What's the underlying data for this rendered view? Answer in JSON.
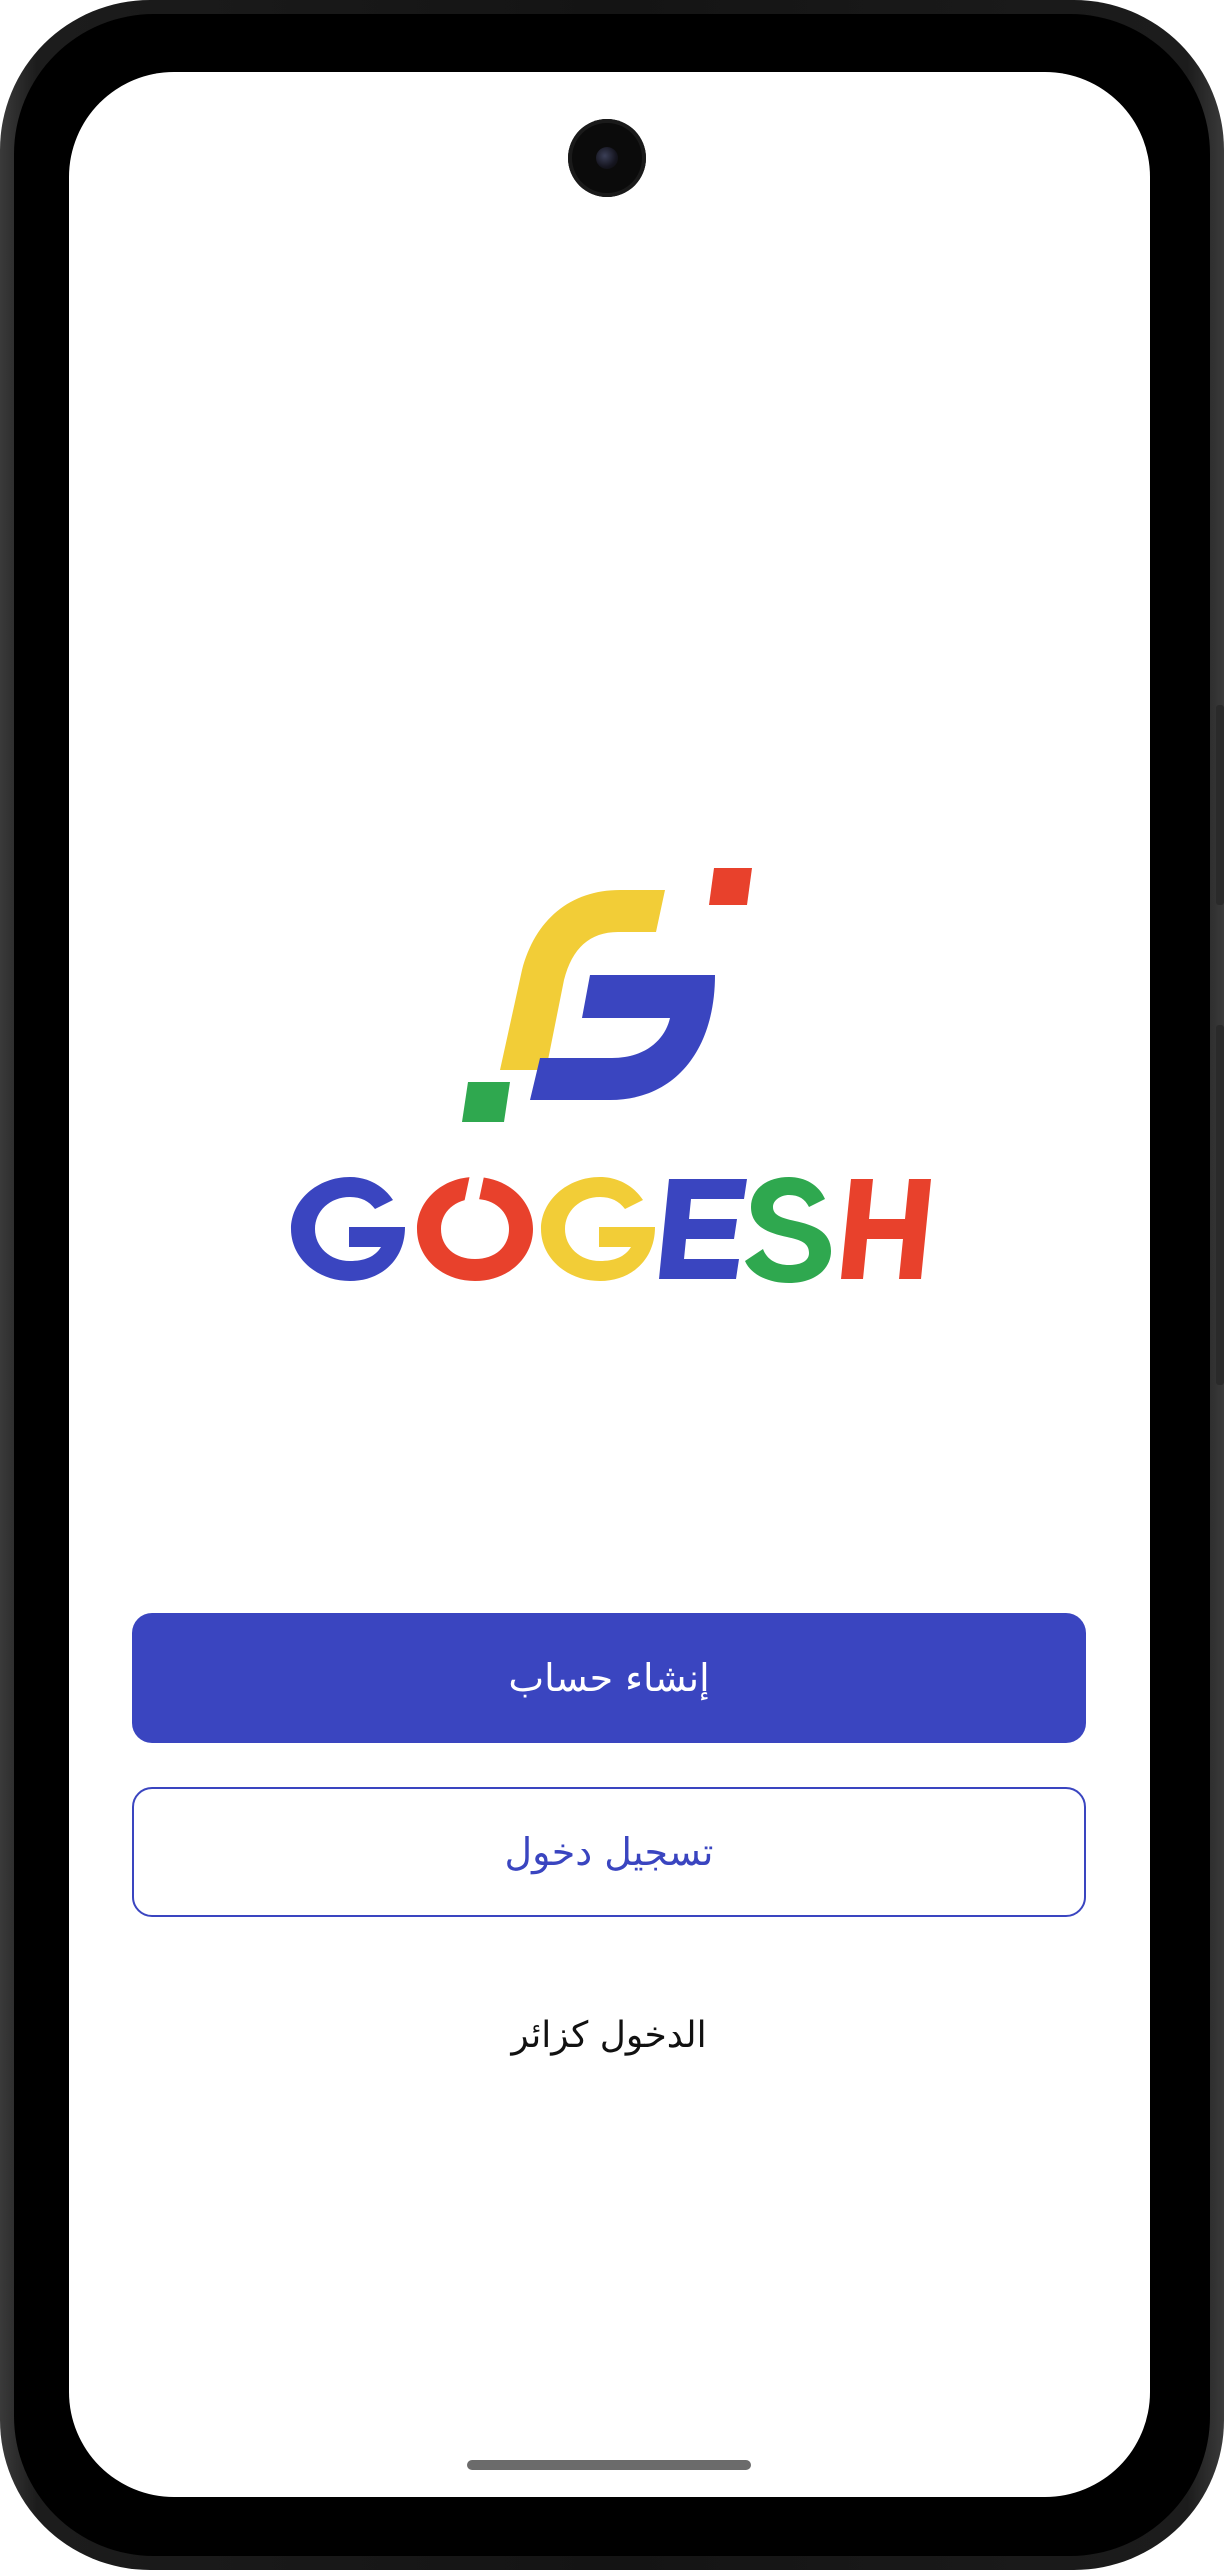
{
  "brand": {
    "name": "GOGESH",
    "letters": [
      "G",
      "O",
      "G",
      "E",
      "S",
      "H"
    ],
    "colors": {
      "blue": "#3a45c0",
      "red": "#e8412c",
      "yellow": "#f2cd37",
      "green": "#2fa84f"
    }
  },
  "actions": {
    "create_account_label": "إنشاء حساب",
    "login_label": "تسجيل دخول",
    "guest_label": "الدخول كزائر"
  },
  "icons": {
    "camera": "front-camera",
    "home": "home-indicator"
  }
}
